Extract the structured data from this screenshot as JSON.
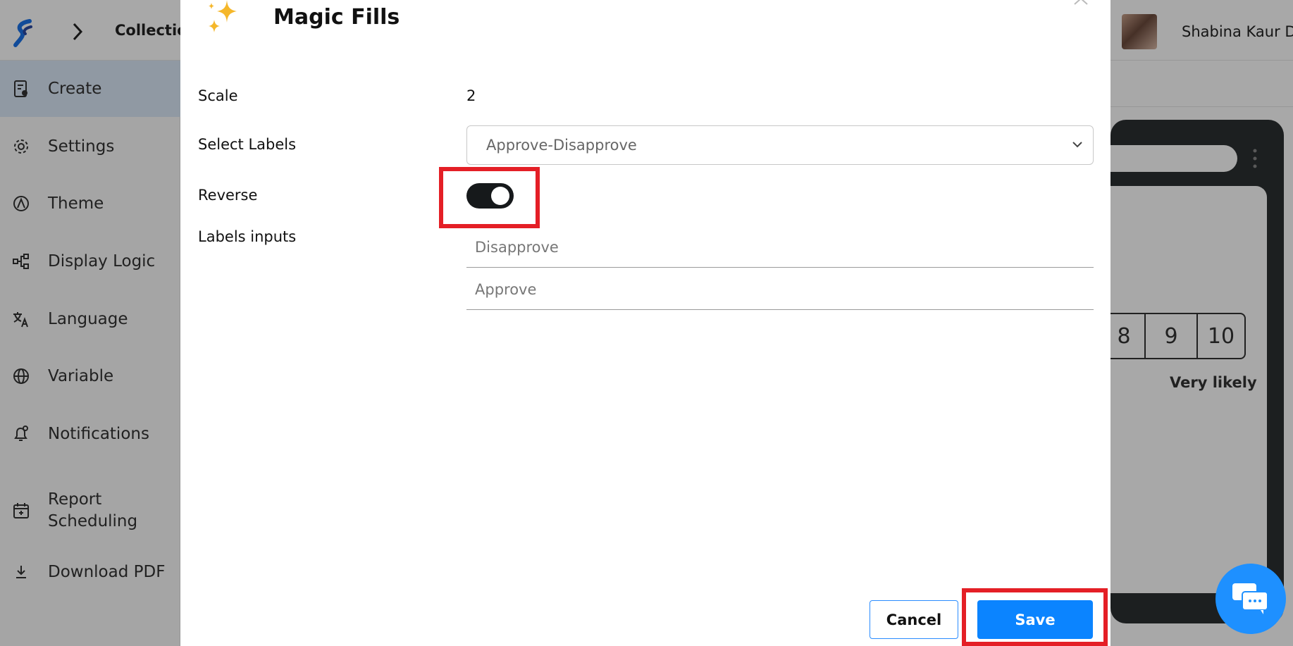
{
  "app": {
    "breadcrumb": "Collectio",
    "user_name": "Shabina Kaur D"
  },
  "sidebar": {
    "items": [
      {
        "label": "Create",
        "icon": "form-edit-icon",
        "active": true
      },
      {
        "label": "Settings",
        "icon": "gear-icon"
      },
      {
        "label": "Theme",
        "icon": "theme-icon"
      },
      {
        "label": "Display Logic",
        "icon": "flow-icon"
      },
      {
        "label": "Language",
        "icon": "translate-icon"
      },
      {
        "label": "Variable",
        "icon": "globe-icon"
      },
      {
        "label": "Notifications",
        "icon": "bell-icon"
      },
      {
        "label": "Report Scheduling",
        "icon": "calendar-icon"
      },
      {
        "label": "Download PDF",
        "icon": "download-icon"
      }
    ]
  },
  "preview": {
    "scale_numbers": [
      "8",
      "9",
      "10"
    ],
    "end_label": "Very likely"
  },
  "modal": {
    "title": "Magic Fills",
    "scale_label": "Scale",
    "scale_value": "2",
    "select_labels_label": "Select Labels",
    "select_value": "Approve-Disapprove",
    "reverse_label": "Reverse",
    "reverse_on": true,
    "labels_inputs_label": "Labels inputs",
    "label_inputs": [
      {
        "placeholder": "Disapprove"
      },
      {
        "placeholder": "Approve"
      }
    ],
    "cancel_label": "Cancel",
    "save_label": "Save"
  },
  "colors": {
    "accent": "#0b84ff",
    "highlight": "#e41f26",
    "toggle_on": "#16191b"
  }
}
